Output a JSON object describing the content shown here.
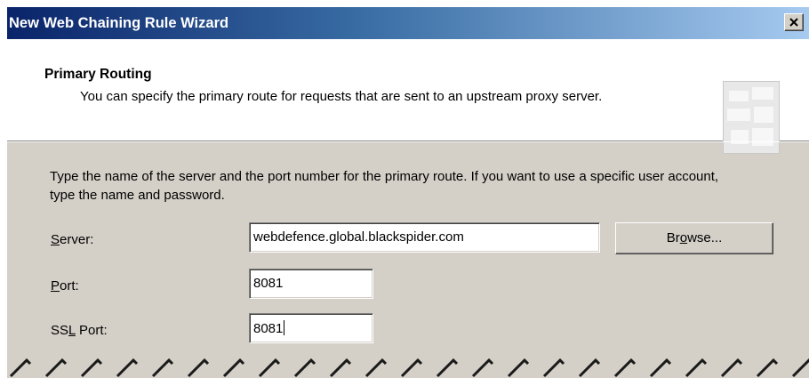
{
  "window": {
    "title": "New Web Chaining Rule Wizard",
    "close_glyph": "x"
  },
  "header": {
    "title": "Primary Routing",
    "description": "You can specify the primary route for requests that are sent to an upstream proxy server."
  },
  "body": {
    "instructions": "Type the name of the server and the port number for the primary route. If you want to use a specific user account, type the name and password."
  },
  "fields": {
    "server": {
      "label_mnemonic": "S",
      "label_rest": "erver:",
      "value": "webdefence.global.blackspider.com"
    },
    "port": {
      "label_mnemonic": "P",
      "label_rest": "ort:",
      "value": "8081"
    },
    "ssl_port": {
      "label_before": "SS",
      "label_mnemonic": "L",
      "label_after": " Port:",
      "value": "8081"
    }
  },
  "buttons": {
    "browse": {
      "label_before": "Br",
      "label_mnemonic": "o",
      "label_after": "wse..."
    }
  },
  "colors": {
    "title_gradient_start": "#0a246a",
    "title_gradient_end": "#a6caf0",
    "dialog_face": "#d4d0c8",
    "header_bg": "#ffffff"
  },
  "icons": {
    "close": "close-icon",
    "header_graphic": "wizard-header-graphic"
  }
}
